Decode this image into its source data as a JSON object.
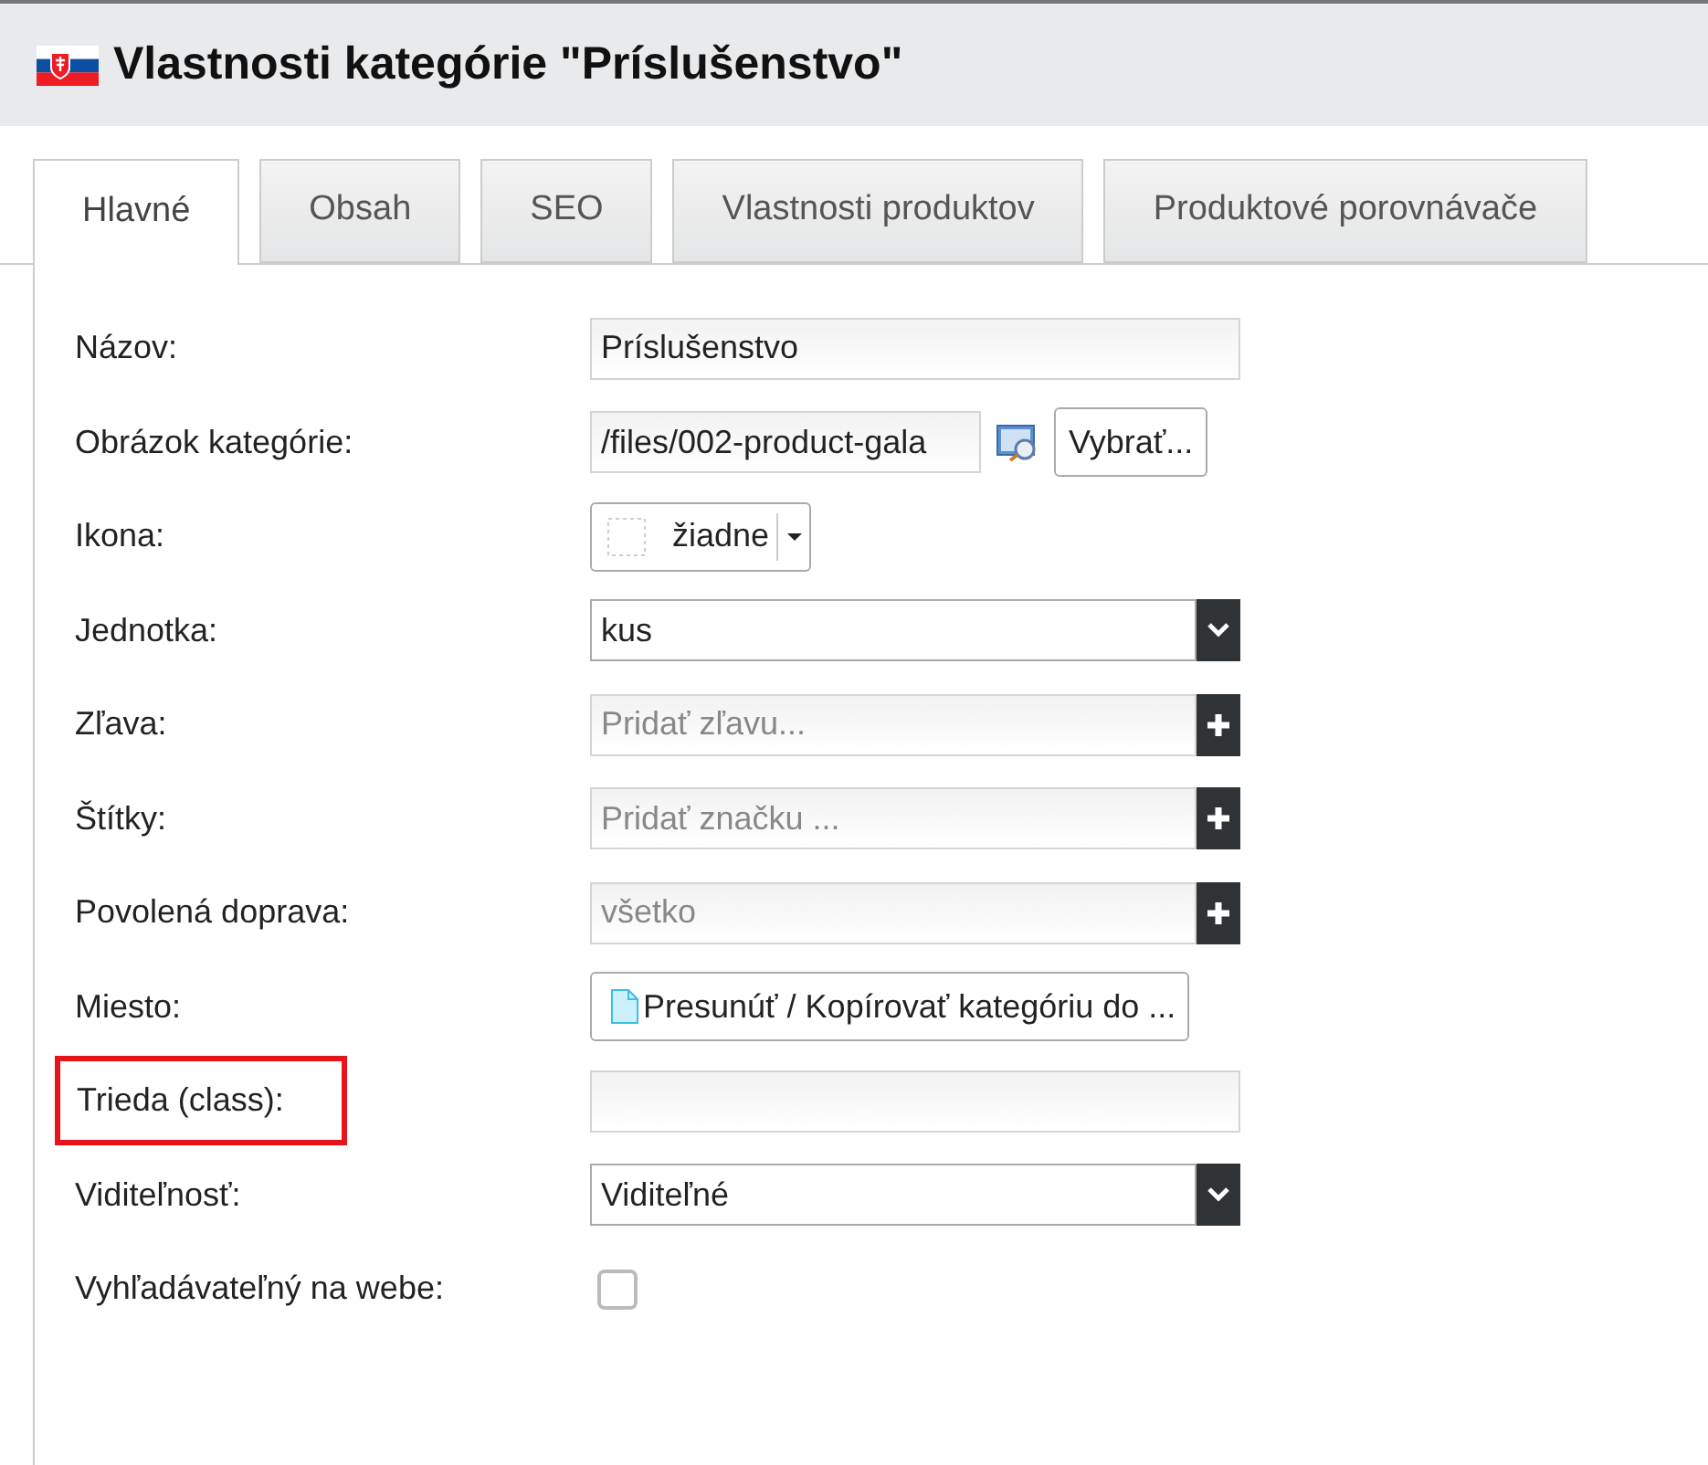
{
  "window": {
    "title": "Vlastnosti kategórie \"Príslušenstvo\""
  },
  "tabs": [
    {
      "label": "Hlavné",
      "selected": true
    },
    {
      "label": "Obsah",
      "selected": false
    },
    {
      "label": "SEO",
      "selected": false
    },
    {
      "label": "Vlastnosti produktov",
      "selected": false
    },
    {
      "label": "Produktové porovnávače",
      "selected": false
    }
  ],
  "fields": [
    {
      "label": "Názov:",
      "kind": "text",
      "value": "Príslušenstvo",
      "highlighted": false
    },
    {
      "label": "Obrázok kategórie:",
      "kind": "file",
      "value": "/files/002-product-gala",
      "button": "Vybrať...",
      "highlighted": false
    },
    {
      "label": "Ikona:",
      "kind": "icon",
      "value": "žiadne",
      "highlighted": false
    },
    {
      "label": "Jednotka:",
      "kind": "select",
      "value": "kus",
      "highlighted": false
    },
    {
      "label": "Zľava:",
      "kind": "add",
      "placeholder": "Pridať zľavu...",
      "highlighted": false
    },
    {
      "label": "Štítky:",
      "kind": "add",
      "placeholder": "Pridať značku ...",
      "highlighted": false
    },
    {
      "label": "Povolená doprava:",
      "kind": "add",
      "placeholder": "všetko",
      "highlighted": false
    },
    {
      "label": "Miesto:",
      "kind": "button",
      "value": "Presunúť / Kopírovať kategóriu do ...",
      "highlighted": false
    },
    {
      "label": "Trieda (class):",
      "kind": "text",
      "highlighted": true
    },
    {
      "label": "Viditeľnosť:",
      "kind": "select",
      "value": "Viditeľné",
      "highlighted": false
    },
    {
      "label": "Vyhľadávateľný na webe:",
      "kind": "checkbox",
      "checked": false,
      "highlighted": false
    }
  ]
}
